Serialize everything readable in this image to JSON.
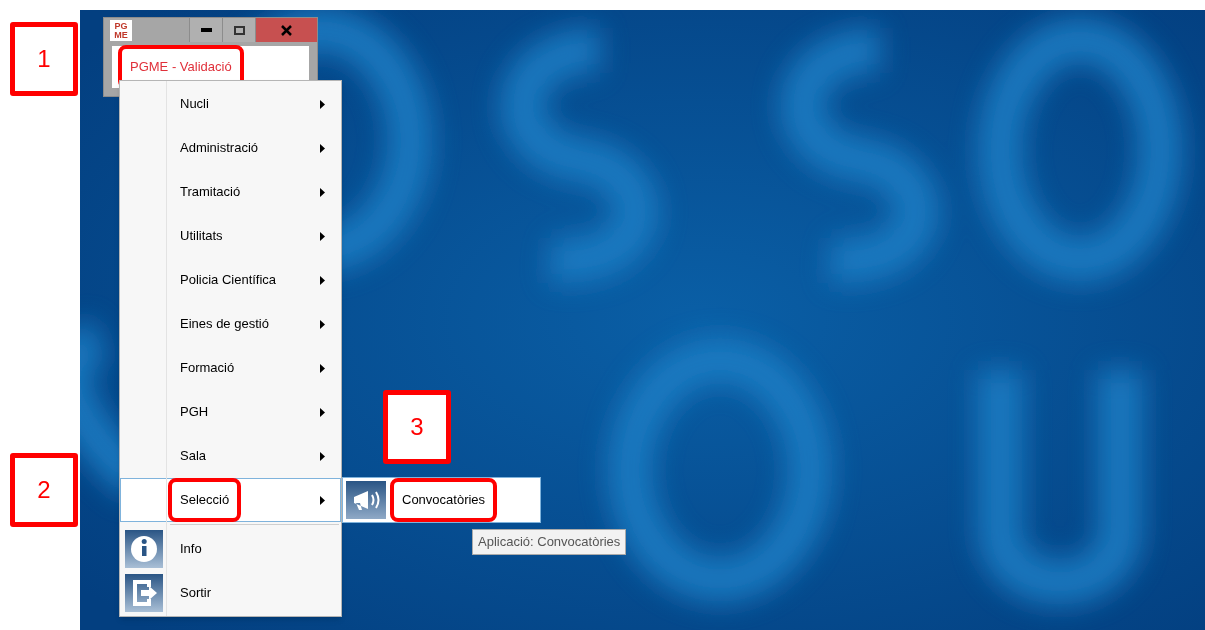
{
  "window": {
    "app_icon": [
      "PG",
      "ME"
    ],
    "title_field": {
      "text": "PGME - Validació",
      "highlighted": true
    }
  },
  "menu": {
    "items": [
      {
        "label": "Nucli",
        "kind": "submenu",
        "selected": false,
        "highlighted": false
      },
      {
        "label": "Administració",
        "kind": "submenu",
        "selected": false,
        "highlighted": false
      },
      {
        "label": "Tramitació",
        "kind": "submenu",
        "selected": false,
        "highlighted": false
      },
      {
        "label": "Utilitats",
        "kind": "submenu",
        "selected": false,
        "highlighted": false
      },
      {
        "label": "Policia Científica",
        "kind": "submenu",
        "selected": false,
        "highlighted": false
      },
      {
        "label": "Eines de gestió",
        "kind": "submenu",
        "selected": false,
        "highlighted": false
      },
      {
        "label": "Formació",
        "kind": "submenu",
        "selected": false,
        "highlighted": false
      },
      {
        "label": "PGH",
        "kind": "submenu",
        "selected": false,
        "highlighted": false
      },
      {
        "label": "Sala",
        "kind": "submenu",
        "selected": false,
        "highlighted": false
      },
      {
        "label": "Selecció",
        "kind": "submenu",
        "selected": true,
        "highlighted": true
      },
      {
        "label": "Info",
        "kind": "info",
        "selected": false,
        "highlighted": false
      },
      {
        "label": "Sortir",
        "kind": "exit",
        "selected": false,
        "highlighted": false
      }
    ]
  },
  "submenu": {
    "items": [
      {
        "label": "Convocatòries",
        "highlighted": true
      }
    ]
  },
  "tooltip": "Aplicació: Convocatòries",
  "callouts": [
    {
      "label": "1"
    },
    {
      "label": "2"
    },
    {
      "label": "3"
    }
  ]
}
